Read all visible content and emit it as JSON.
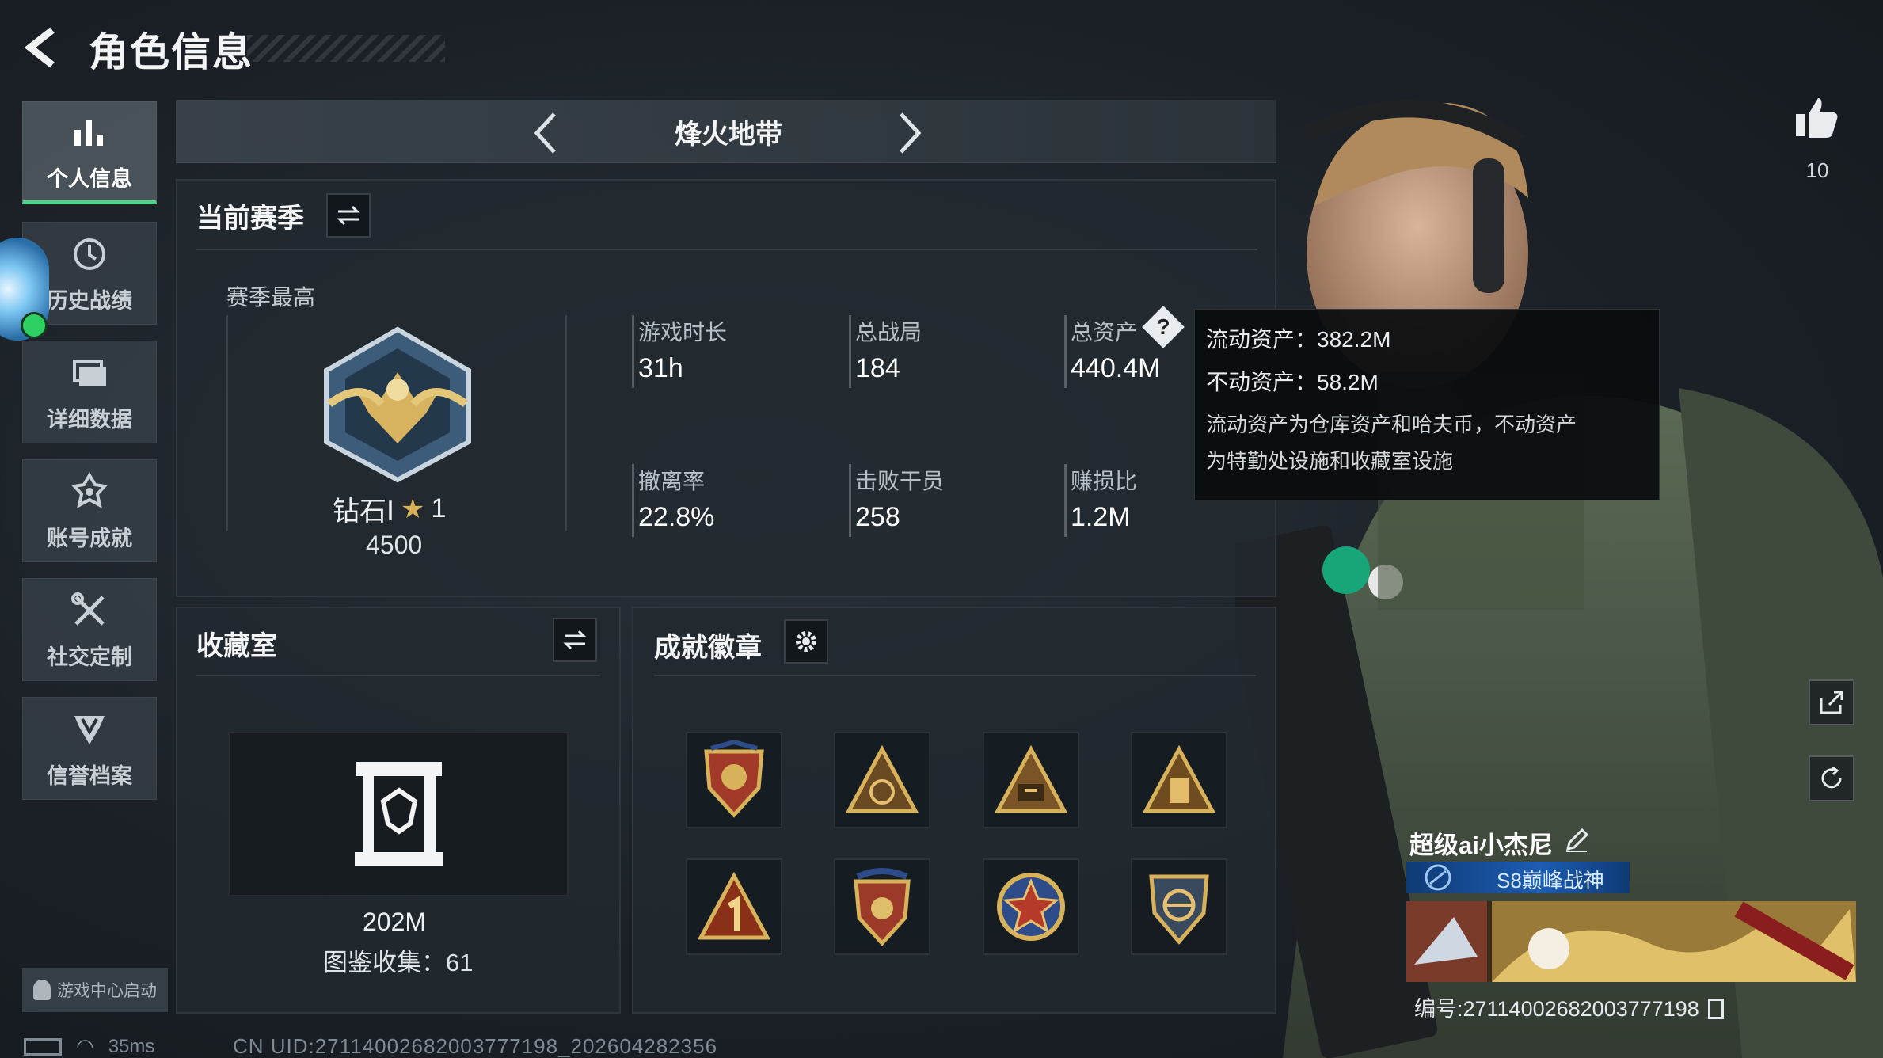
{
  "header": {
    "title": "角色信息"
  },
  "sidebar": {
    "items": [
      {
        "label": "个人信息",
        "icon": "bar-chart-icon",
        "active": true
      },
      {
        "label": "历史战绩",
        "icon": "history-clock-icon",
        "active": false
      },
      {
        "label": "详细数据",
        "icon": "data-stack-icon",
        "active": false
      },
      {
        "label": "账号成就",
        "icon": "achievement-star-icon",
        "active": false
      },
      {
        "label": "社交定制",
        "icon": "tools-cross-icon",
        "active": false
      },
      {
        "label": "信誉档案",
        "icon": "credit-shield-icon",
        "active": false
      }
    ],
    "launch_label": "游戏中心启动"
  },
  "mode": {
    "title": "烽火地带"
  },
  "season": {
    "title": "当前赛季",
    "best_label": "赛季最高",
    "rank_name": "钻石Ⅰ",
    "rank_stars": "1",
    "rank_points": "4500",
    "stats": [
      {
        "label": "游戏时长",
        "value": "31h"
      },
      {
        "label": "总战局",
        "value": "184"
      },
      {
        "label": "总资产",
        "value": "440.4M"
      },
      {
        "label": "撤离率",
        "value": "22.8%"
      },
      {
        "label": "击败干员",
        "value": "258"
      },
      {
        "label": "赚损比",
        "value": "1.2M"
      }
    ]
  },
  "tooltip": {
    "liquid": "流动资产：382.2M",
    "fixed": "不动资产：58.2M",
    "note_line1": "流动资产为仓库资产和哈夫币，不动资产",
    "note_line2": "为特勤处设施和收藏室设施"
  },
  "collection": {
    "title": "收藏室",
    "value": "202M",
    "count_label": "图鉴收集：61"
  },
  "badges": {
    "title": "成就徽章",
    "items": [
      {
        "icon": "eagle-shield-badge-icon"
      },
      {
        "icon": "triangle-wreath-badge-icon"
      },
      {
        "icon": "triangle-s6-badge-icon"
      },
      {
        "icon": "triangle-emblem-badge-icon"
      },
      {
        "icon": "triangle-number-one-badge-icon"
      },
      {
        "icon": "crest-stars-badge-icon"
      },
      {
        "icon": "star-medal-badge-icon"
      },
      {
        "icon": "globe-shield-badge-icon"
      }
    ]
  },
  "character": {
    "likes": "10",
    "nickname": "超级ai小杰尼",
    "title_tag": "S8巅峰战神",
    "player_id": "编号:2711400268200377719​8"
  },
  "status_bar": {
    "ping": "35ms",
    "uid": "CN UID:2711400268200377719​8_202604282356"
  },
  "colors": {
    "accent": "#4fd48a",
    "gold": "#d8b25a",
    "tag_blue": "#1c5db3"
  }
}
